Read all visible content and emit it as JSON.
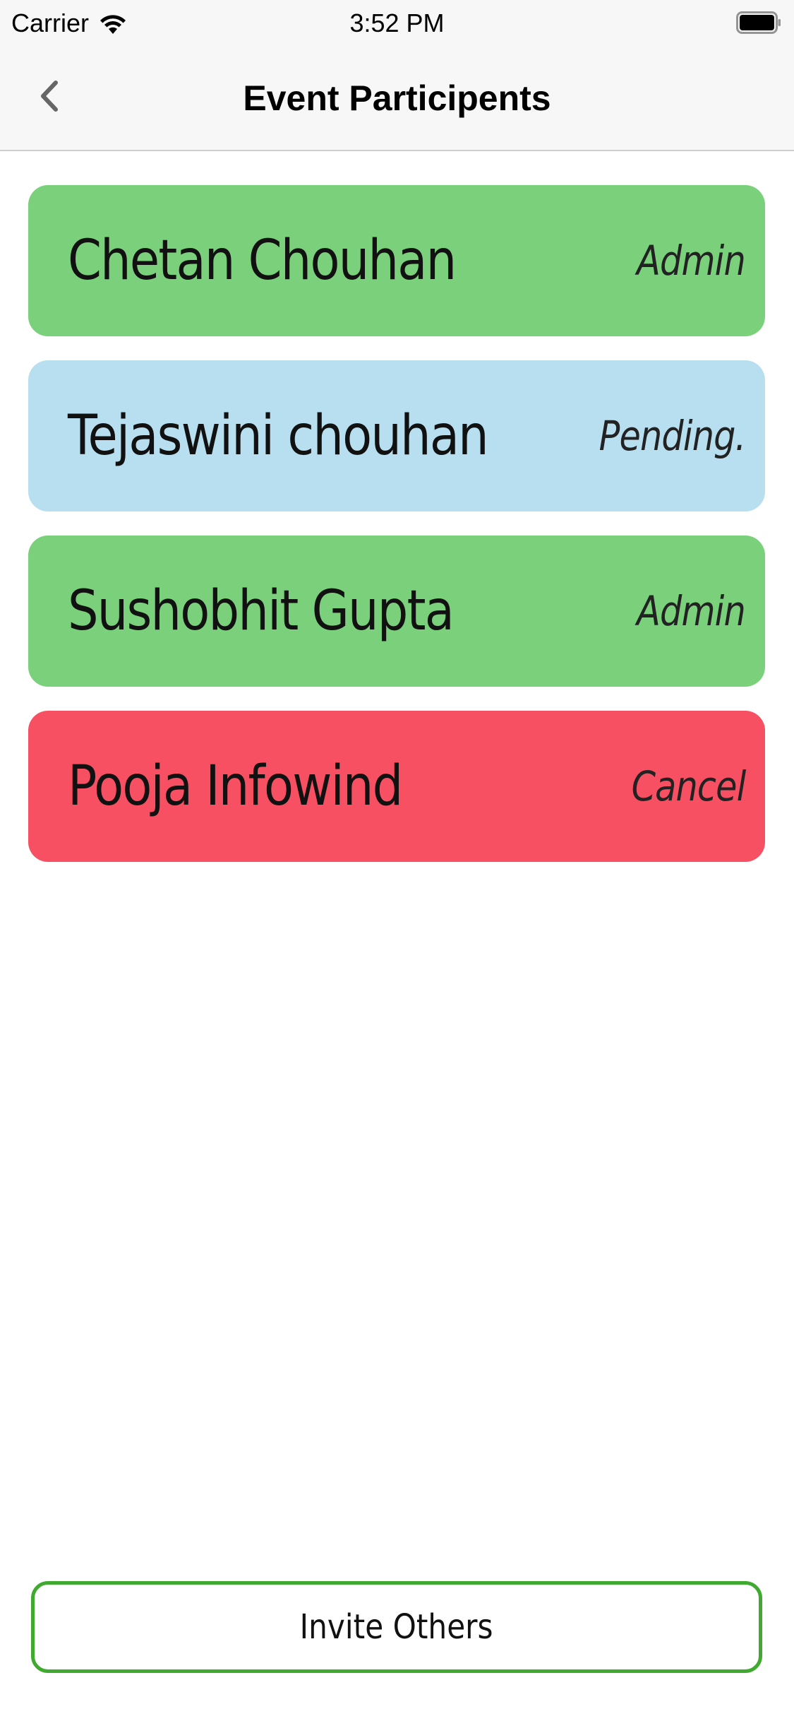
{
  "status_bar": {
    "carrier": "Carrier",
    "time": "3:52 PM",
    "wifi_icon": "wifi-icon",
    "battery_icon": "battery-icon"
  },
  "nav": {
    "title": "Event Participents",
    "back_icon": "chevron-left-icon"
  },
  "participants": [
    {
      "name": "Chetan Chouhan",
      "status": "Admin",
      "color": "#7bd07b"
    },
    {
      "name": "Tejaswini chouhan",
      "status": "Pending.",
      "color": "#b8dff0"
    },
    {
      "name": "Sushobhit Gupta",
      "status": "Admin",
      "color": "#7bd07b"
    },
    {
      "name": "Pooja Infowind",
      "status": "Cancel",
      "color": "#f75063"
    }
  ],
  "footer": {
    "invite_label": "Invite Others",
    "border_color": "#3faa2f"
  }
}
